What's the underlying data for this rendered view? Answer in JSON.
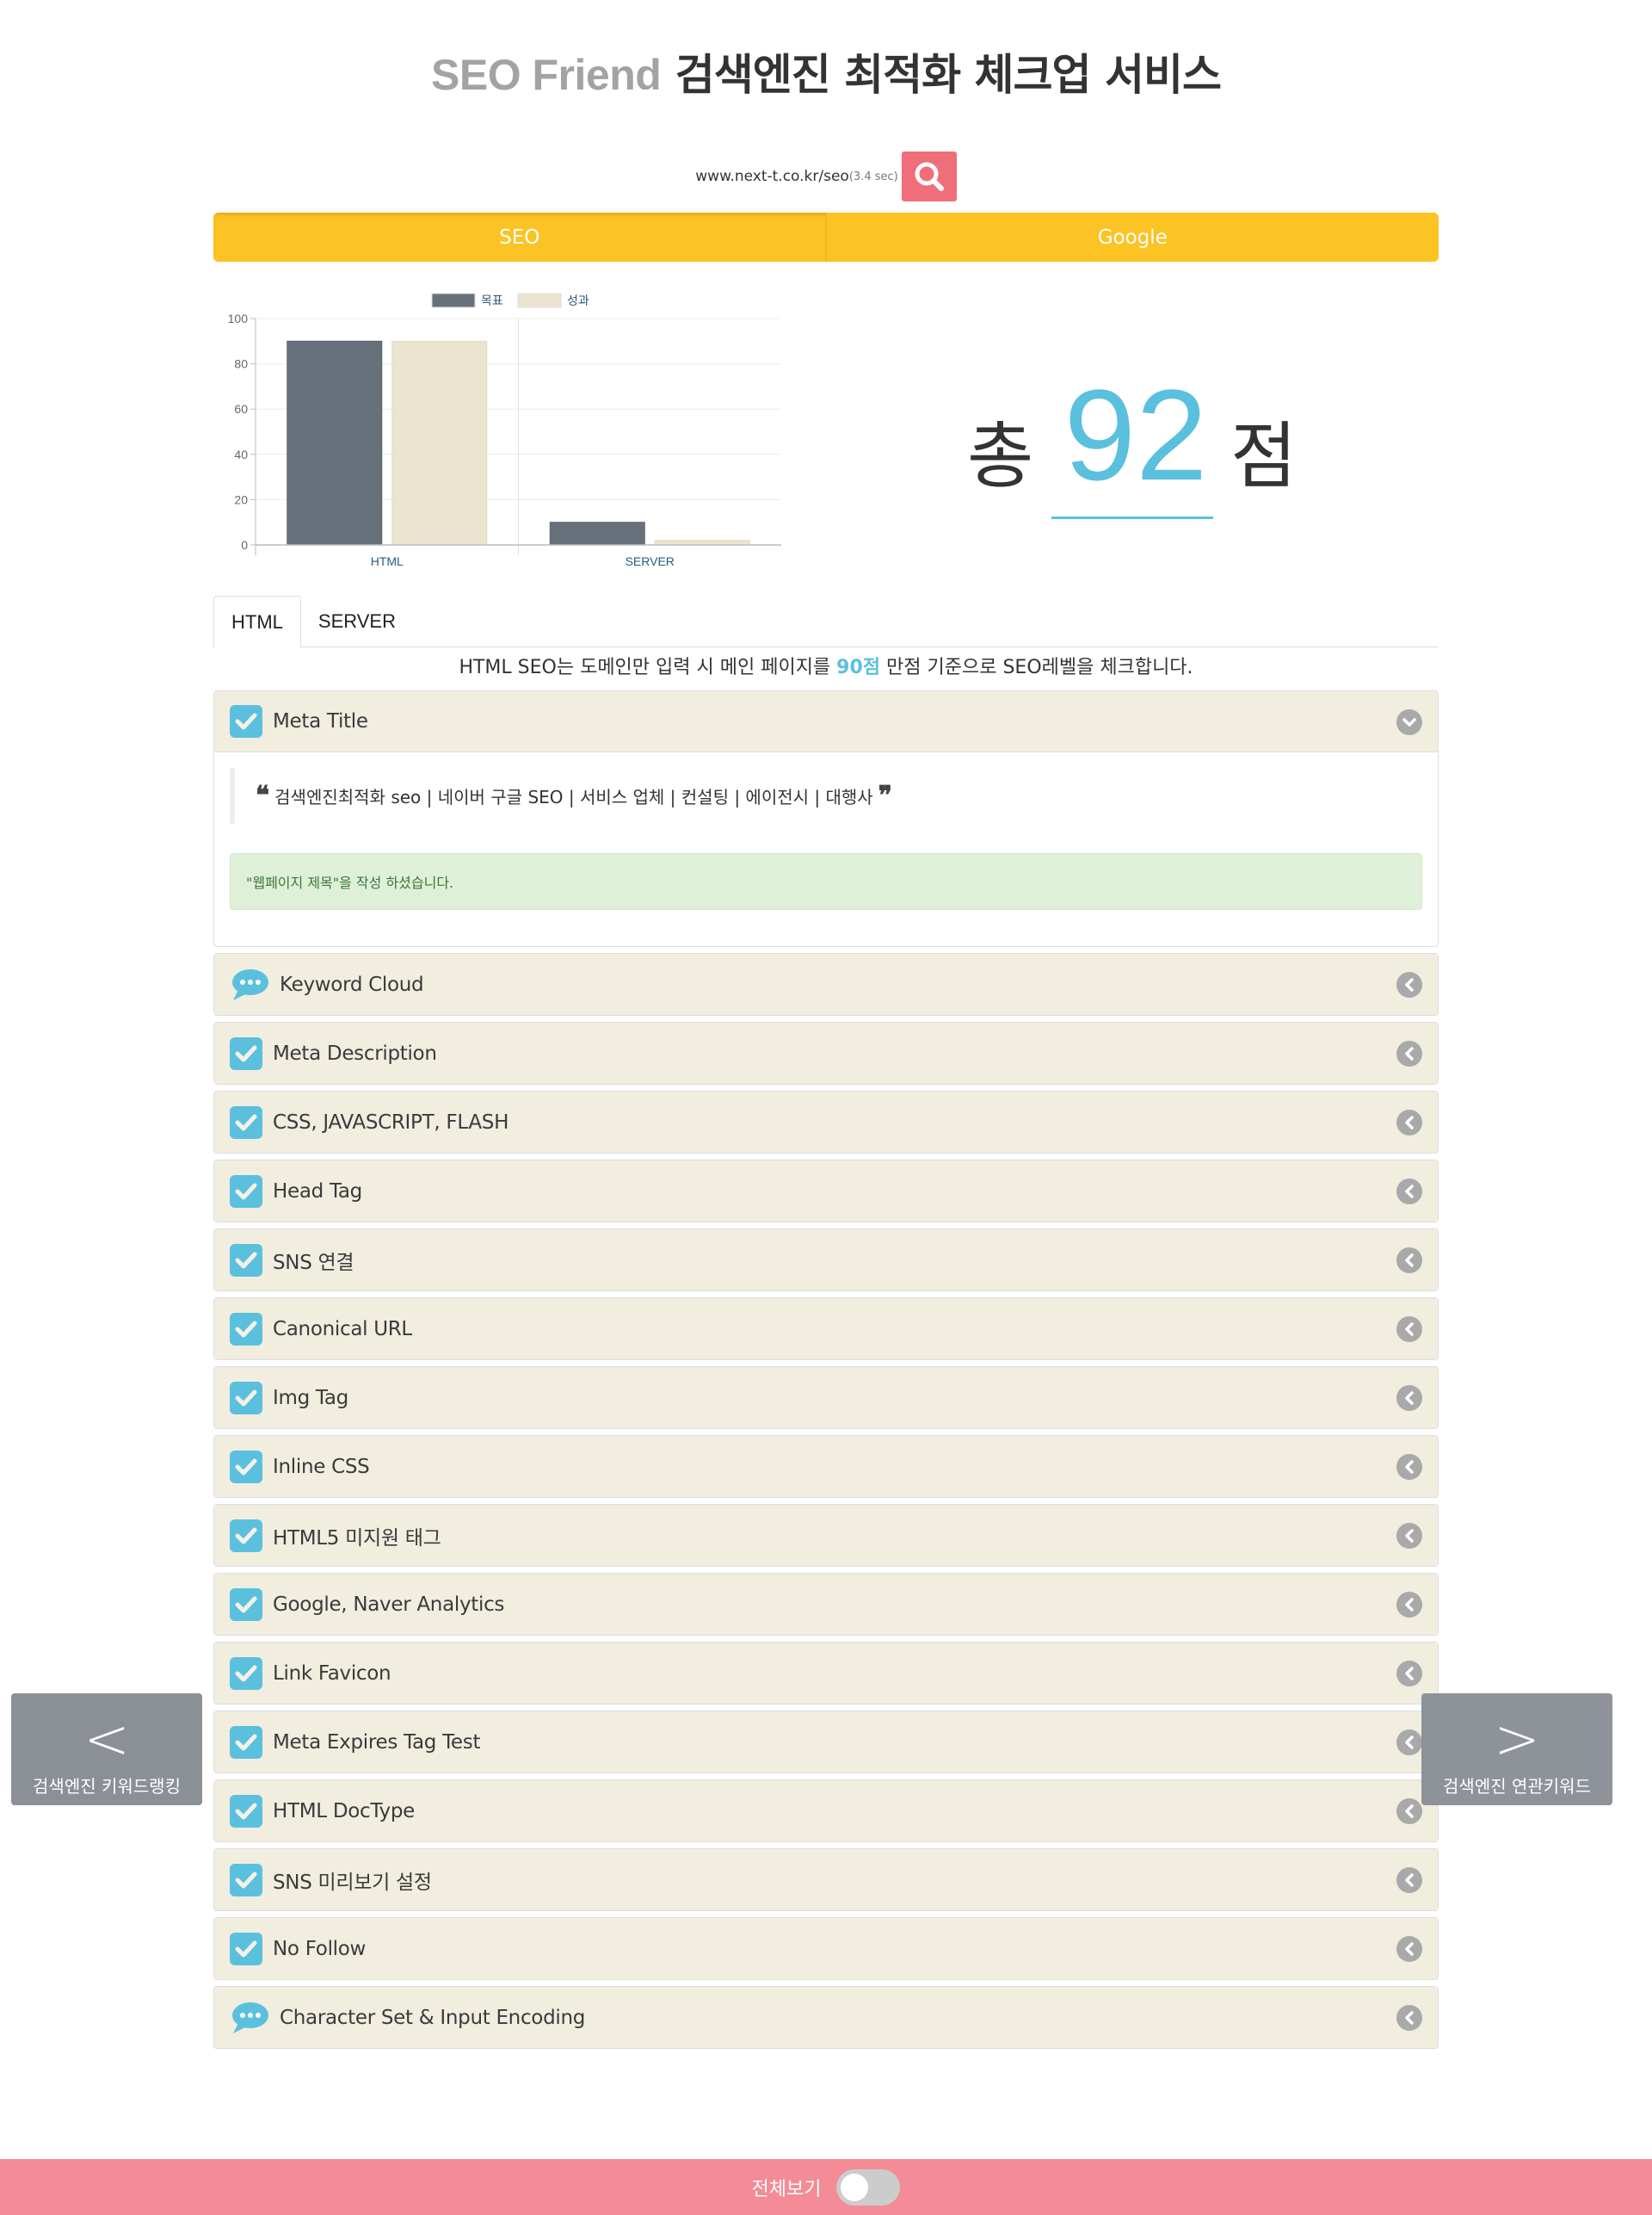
{
  "header": {
    "brand": "SEO Friend",
    "title": "검색엔진 최적화 체크업 서비스"
  },
  "search": {
    "url": "www.next-t.co.kr/seo",
    "elapsed": "(3.4 sec)",
    "button_icon": "search-icon"
  },
  "main_tabs": [
    {
      "label": "SEO",
      "active": true
    },
    {
      "label": "Google",
      "active": false
    }
  ],
  "colors": {
    "accent_yellow": "#fcc324",
    "score_blue": "#5bc0de",
    "search_red": "#f06e7a",
    "footer_pink": "#f38c96",
    "panel_bg": "#f1eddf",
    "target_bar": "#67717c",
    "result_bar": "#ebe5d0"
  },
  "chart_data": {
    "type": "bar",
    "title": "",
    "categories": [
      "HTML",
      "SERVER"
    ],
    "series": [
      {
        "name": "목표",
        "values": [
          90,
          10
        ]
      },
      {
        "name": "성과",
        "values": [
          90,
          2
        ]
      }
    ],
    "xlabel": "",
    "ylabel": "",
    "ylim": [
      0,
      100
    ],
    "yticks": [
      0,
      20,
      40,
      60,
      80,
      100
    ],
    "grid": true,
    "legend": "top-center"
  },
  "score": {
    "prefix": "총",
    "value": "92",
    "suffix": "점"
  },
  "sub_tabs": [
    {
      "label": "HTML",
      "active": true
    },
    {
      "label": "SERVER",
      "active": false
    }
  ],
  "intro": {
    "before": "HTML SEO는 도메인만 입력 시 메인 페이지를 ",
    "highlight": "90점",
    "after": " 만점 기준으로 SEO레벨을 체크합니다."
  },
  "panels": [
    {
      "title": "Meta Title",
      "icon": "check",
      "open": true
    },
    {
      "title": "Keyword Cloud",
      "icon": "comment",
      "open": false
    },
    {
      "title": "Meta Description",
      "icon": "check",
      "open": false
    },
    {
      "title": "CSS, JAVASCRIPT, FLASH",
      "icon": "check",
      "open": false
    },
    {
      "title": "Head Tag",
      "icon": "check",
      "open": false
    },
    {
      "title": "SNS 연결",
      "icon": "check",
      "open": false
    },
    {
      "title": "Canonical URL",
      "icon": "check",
      "open": false
    },
    {
      "title": "Img Tag",
      "icon": "check",
      "open": false
    },
    {
      "title": "Inline CSS",
      "icon": "check",
      "open": false
    },
    {
      "title": "HTML5 미지원 태그",
      "icon": "check",
      "open": false
    },
    {
      "title": "Google, Naver Analytics",
      "icon": "check",
      "open": false
    },
    {
      "title": "Link Favicon",
      "icon": "check",
      "open": false
    },
    {
      "title": "Meta Expires Tag Test",
      "icon": "check",
      "open": false
    },
    {
      "title": "HTML DocType",
      "icon": "check",
      "open": false
    },
    {
      "title": "SNS 미리보기 설정",
      "icon": "check",
      "open": false
    },
    {
      "title": "No Follow",
      "icon": "check",
      "open": false
    },
    {
      "title": "Character Set & Input Encoding",
      "icon": "comment",
      "open": false
    }
  ],
  "meta_title_detail": {
    "quote": "검색엔진최적화 seo | 네이버 구글 SEO | 서비스 업체 | 컨설팅 | 에이전시 | 대행사",
    "open_quote": "❝",
    "close_quote": "❞",
    "message": "\"웹페이지 제목\"을 작성 하셨습니다."
  },
  "side_nav": {
    "prev": {
      "arrow": "<",
      "label": "검색엔진 키워드랭킹"
    },
    "next": {
      "arrow": ">",
      "label": "검색엔진 연관키워드"
    }
  },
  "footer": {
    "label": "전체보기",
    "toggle_on": false
  }
}
